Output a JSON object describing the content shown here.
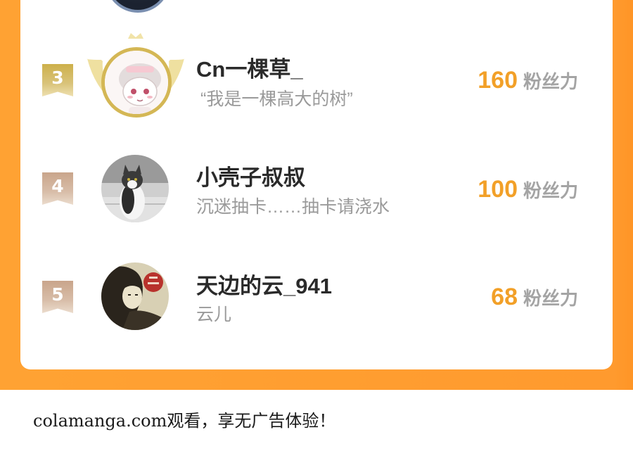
{
  "ranking": [
    {
      "rank": "3",
      "name": "Cn一棵草_",
      "bio": "“我是一棵高大的树”",
      "score": "160",
      "score_unit": "粉丝力",
      "badge_color": "#d4b755"
    },
    {
      "rank": "4",
      "name": "小壳子叔叔",
      "bio": "沉迷抽卡……抽卡请浇水",
      "score": "100",
      "score_unit": "粉丝力",
      "badge_color": "#d3b39c"
    },
    {
      "rank": "5",
      "name": "天边的云_941",
      "bio": "云儿",
      "score": "68",
      "score_unit": "粉丝力",
      "badge_color": "#d3b39c"
    }
  ],
  "colors": {
    "background_accent": "#ff9f2f",
    "score": "#f2a028",
    "gold_badge": "#d4b755",
    "bronze_badge": "#d3b39c"
  },
  "footer": {
    "text": "colamanga.com观看，享无广告体验！"
  }
}
